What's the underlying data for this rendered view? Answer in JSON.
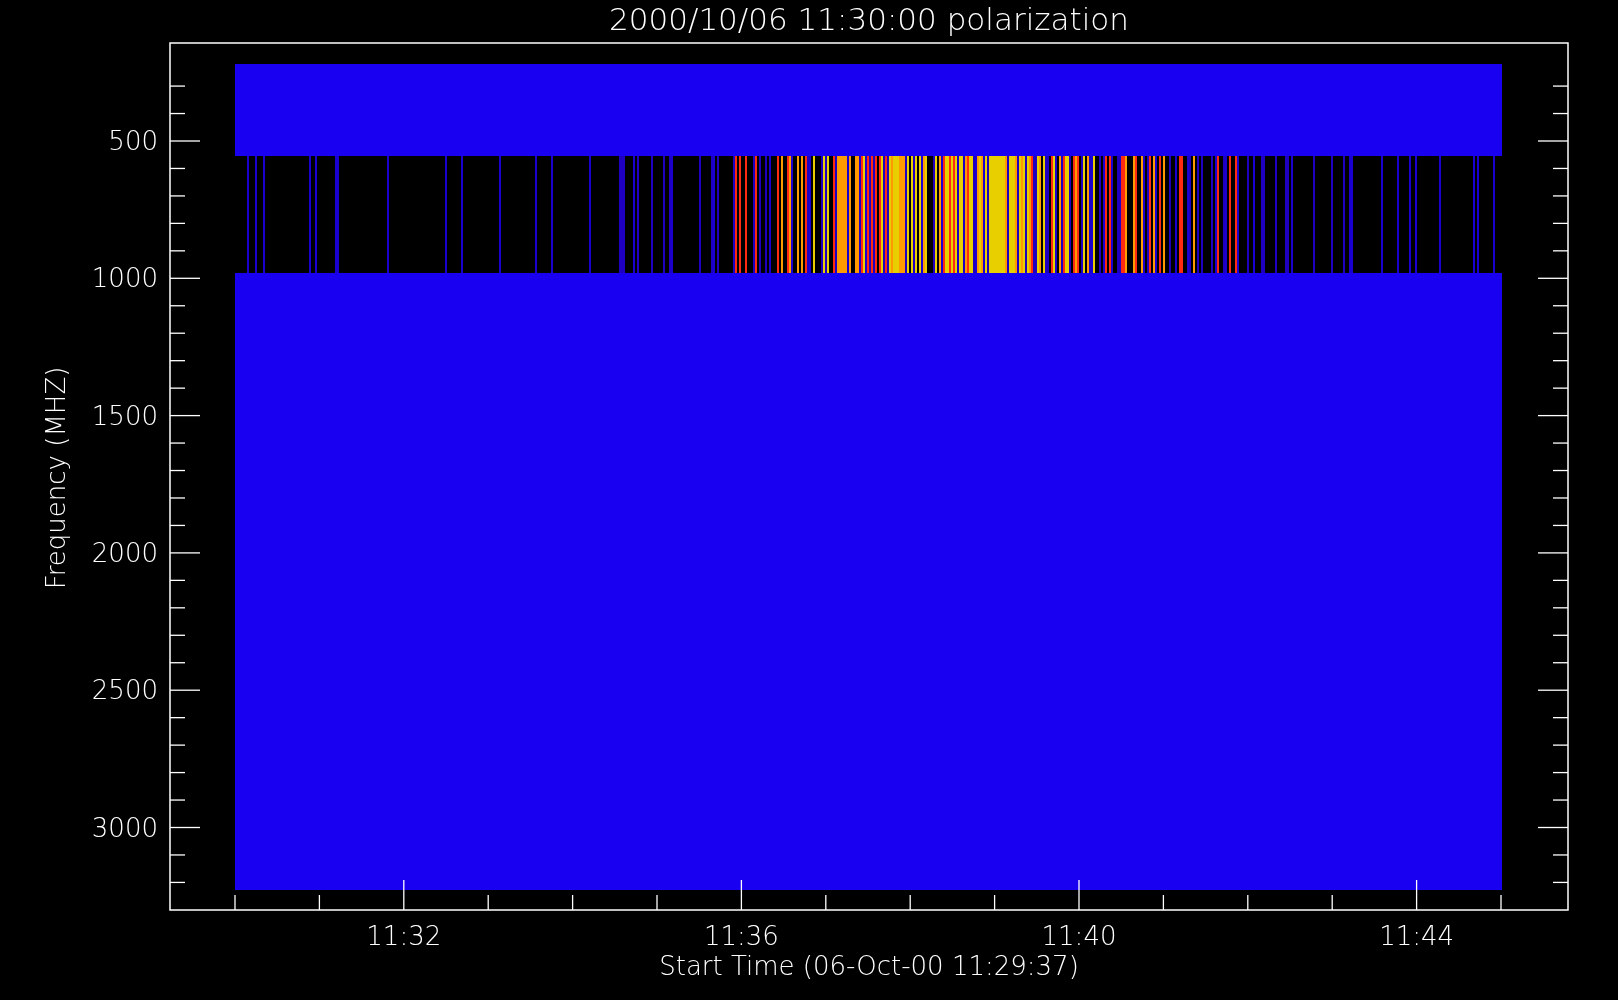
{
  "title": "2000/10/06 11:30:00 polarization",
  "y_axis": {
    "label": "Frequency (MHZ)",
    "ticks": [
      "500",
      "1000",
      "1500",
      "2000",
      "2500",
      "3000"
    ]
  },
  "x_axis": {
    "label": "Start Time (06-Oct-00 11:29:37)",
    "ticks": [
      "11:32",
      "11:36",
      "11:40",
      "11:44"
    ]
  }
}
